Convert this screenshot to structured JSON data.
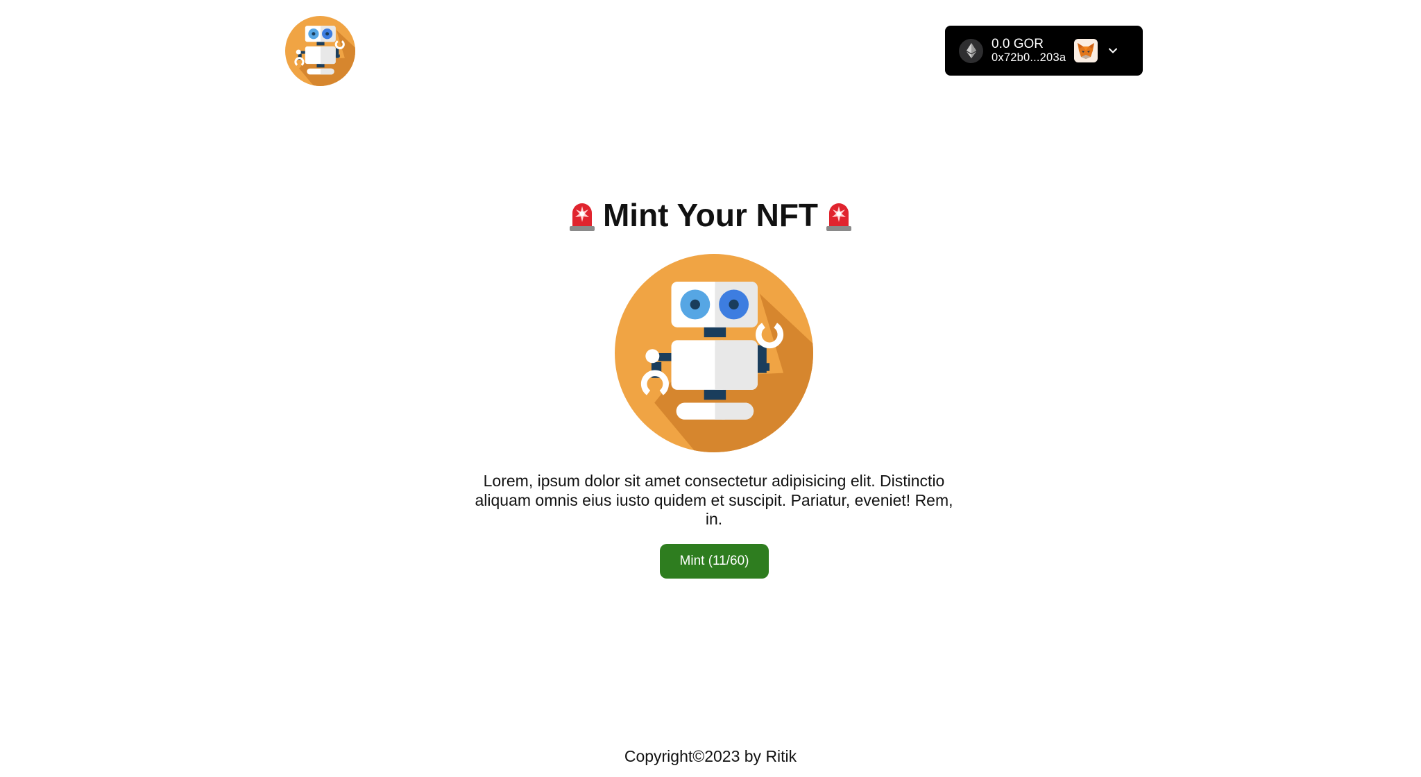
{
  "header": {
    "logo_icon": "robot-logo-icon",
    "wallet": {
      "network_icon": "ethereum-icon",
      "balance": "0.0 GOR",
      "address": "0x72b0...203a",
      "avatar_icon": "metamask-fox-icon",
      "dropdown_icon": "chevron-down-icon"
    }
  },
  "main": {
    "title": "Mint Your NFT",
    "title_icon": "siren-emoji",
    "image_icon": "robot-nft-image",
    "description": "Lorem, ipsum dolor sit amet consectetur adipisicing elit. Distinctio aliquam omnis eius iusto quidem et suscipit. Pariatur, eveniet! Rem, in.",
    "mint_button_label": "Mint (11/60)"
  },
  "footer": {
    "copyright": "Copyright©2023 by Ritik"
  },
  "colors": {
    "accent_orange": "#f0a444",
    "mint_button": "#2e7d1f",
    "wallet_bg": "#000000"
  }
}
